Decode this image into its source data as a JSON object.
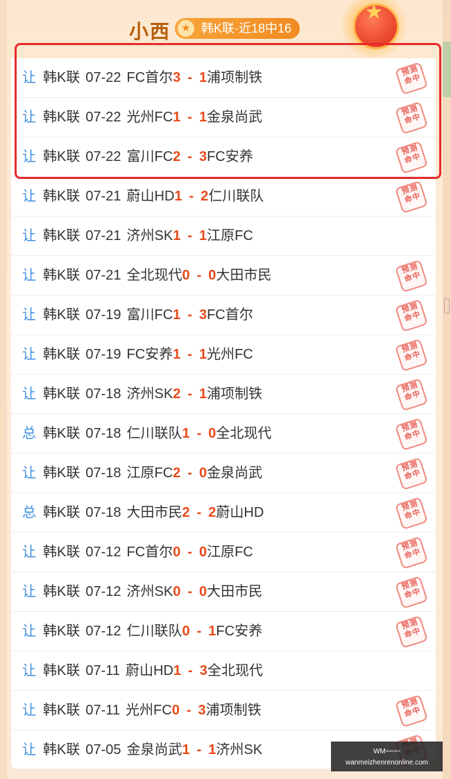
{
  "header": {
    "title": "小西",
    "badge_text": "韩K联·近18中16"
  },
  "colors": {
    "type_color": "#3d8fe0",
    "score_color": "#e84a1a",
    "highlight_border": "#e52a2a",
    "stamp_color": "#e8625a",
    "badge_gradient": [
      "#f8a53b",
      "#f28a20"
    ]
  },
  "stamp_text": [
    "预测",
    "命中"
  ],
  "rows": [
    {
      "type": "让",
      "league": "韩K联",
      "date": "07-22",
      "home": "FC首尔",
      "home_score": "3",
      "away_score": "1",
      "away": "浦项制铁",
      "hit": true
    },
    {
      "type": "让",
      "league": "韩K联",
      "date": "07-22",
      "home": "光州FC",
      "home_score": "1",
      "away_score": "1",
      "away": "金泉尚武",
      "hit": true
    },
    {
      "type": "让",
      "league": "韩K联",
      "date": "07-22",
      "home": "富川FC",
      "home_score": "2",
      "away_score": "3",
      "away": "FC安养",
      "hit": true
    },
    {
      "type": "让",
      "league": "韩K联",
      "date": "07-21",
      "home": "蔚山HD",
      "home_score": "1",
      "away_score": "2",
      "away": "仁川联队",
      "hit": true
    },
    {
      "type": "让",
      "league": "韩K联",
      "date": "07-21",
      "home": "济州SK",
      "home_score": "1",
      "away_score": "1",
      "away": "江原FC",
      "hit": false
    },
    {
      "type": "让",
      "league": "韩K联",
      "date": "07-21",
      "home": "全北现代",
      "home_score": "0",
      "away_score": "0",
      "away": "大田市民",
      "hit": true
    },
    {
      "type": "让",
      "league": "韩K联",
      "date": "07-19",
      "home": "富川FC",
      "home_score": "1",
      "away_score": "3",
      "away": "FC首尔",
      "hit": true
    },
    {
      "type": "让",
      "league": "韩K联",
      "date": "07-19",
      "home": "FC安养",
      "home_score": "1",
      "away_score": "1",
      "away": "光州FC",
      "hit": true
    },
    {
      "type": "让",
      "league": "韩K联",
      "date": "07-18",
      "home": "济州SK",
      "home_score": "2",
      "away_score": "1",
      "away": "浦项制铁",
      "hit": true
    },
    {
      "type": "总",
      "league": "韩K联",
      "date": "07-18",
      "home": "仁川联队",
      "home_score": "1",
      "away_score": "0",
      "away": "全北现代",
      "hit": true
    },
    {
      "type": "让",
      "league": "韩K联",
      "date": "07-18",
      "home": "江原FC",
      "home_score": "2",
      "away_score": "0",
      "away": "金泉尚武",
      "hit": true
    },
    {
      "type": "总",
      "league": "韩K联",
      "date": "07-18",
      "home": "大田市民",
      "home_score": "2",
      "away_score": "2",
      "away": "蔚山HD",
      "hit": true
    },
    {
      "type": "让",
      "league": "韩K联",
      "date": "07-12",
      "home": "FC首尔",
      "home_score": "0",
      "away_score": "0",
      "away": "江原FC",
      "hit": true
    },
    {
      "type": "让",
      "league": "韩K联",
      "date": "07-12",
      "home": "济州SK",
      "home_score": "0",
      "away_score": "0",
      "away": "大田市民",
      "hit": true
    },
    {
      "type": "让",
      "league": "韩K联",
      "date": "07-12",
      "home": "仁川联队",
      "home_score": "0",
      "away_score": "1",
      "away": "FC安养",
      "hit": true
    },
    {
      "type": "让",
      "league": "韩K联",
      "date": "07-11",
      "home": "蔚山HD",
      "home_score": "1",
      "away_score": "3",
      "away": "全北现代",
      "hit": false
    },
    {
      "type": "让",
      "league": "韩K联",
      "date": "07-11",
      "home": "光州FC",
      "home_score": "0",
      "away_score": "3",
      "away": "浦项制铁",
      "hit": true
    },
    {
      "type": "让",
      "league": "韩K联",
      "date": "07-05",
      "home": "金泉尚武",
      "home_score": "1",
      "away_score": "1",
      "away": "济州SK",
      "hit": true
    }
  ],
  "watermark": {
    "line1": "WM▫▫▫▫▫▫",
    "line2": "wanmeizhenrenonline.com"
  }
}
